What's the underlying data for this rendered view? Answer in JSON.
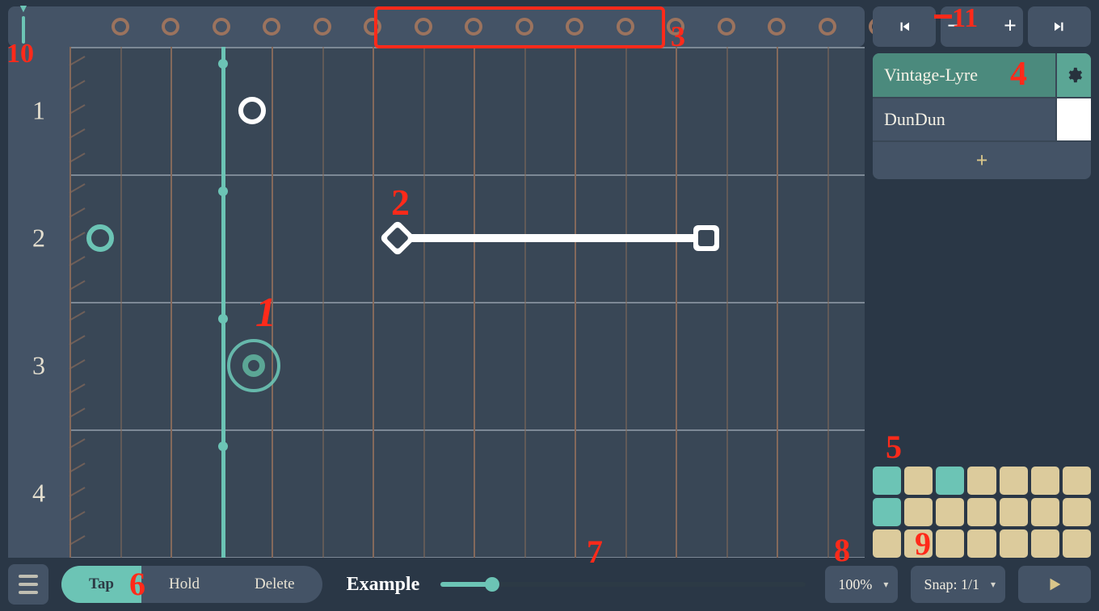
{
  "timeline": {
    "beat_count": 16,
    "playhead_column": 4
  },
  "rows": [
    "1",
    "2",
    "3",
    "4"
  ],
  "instruments": [
    {
      "name": "Vintage-Lyre",
      "selected": true
    },
    {
      "name": "DunDun",
      "selected": false
    }
  ],
  "tools": {
    "tap": "Tap",
    "hold": "Hold",
    "delete": "Delete",
    "active": "tap"
  },
  "song_name": "Example",
  "playback": {
    "position_percent": 14
  },
  "zoom": "100%",
  "snap": "Snap: 1/1",
  "pads": {
    "rows": 3,
    "cols": 7,
    "teal_cells": [
      [
        0,
        0
      ],
      [
        0,
        2
      ],
      [
        1,
        0
      ]
    ]
  },
  "annotations": {
    "1": "1",
    "2": "2",
    "3": "3",
    "4": "4",
    "5": "5",
    "6": "6",
    "7": "7",
    "8": "8",
    "9": "9",
    "10": "10",
    "11": "11"
  },
  "icons": {
    "settings": "gear-icon",
    "add": "+",
    "prev": "skip-back-icon",
    "next": "skip-forward-icon",
    "minus": "−",
    "plus": "+",
    "play": "play-icon"
  }
}
